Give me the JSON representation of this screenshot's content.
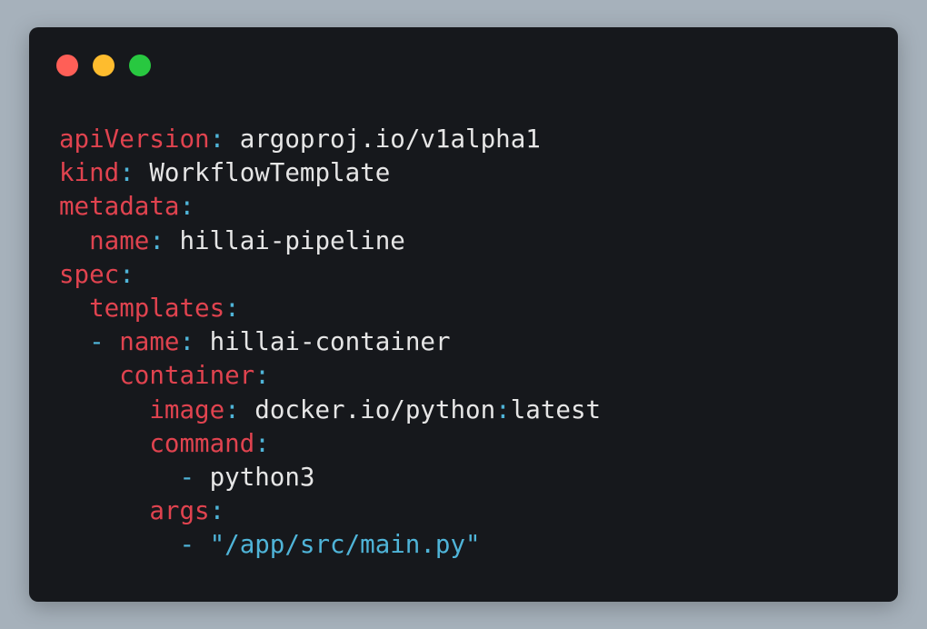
{
  "colors": {
    "page_background": "#a6b1bb",
    "window_background": "#16181c",
    "close": "#ff5f57",
    "minimize": "#febc2e",
    "maximize": "#28c840",
    "key": "#e0434f",
    "punctuation": "#4fb4d8",
    "value": "#e6e6e6",
    "string": "#4fb4d8"
  },
  "window_controls": [
    "close-button",
    "minimize-button",
    "maximize-button"
  ],
  "code": {
    "language": "yaml",
    "lines": [
      {
        "indent": "",
        "dash": "",
        "key": "apiVersion",
        "colon": ":",
        "value": " argoproj.io/v1alpha1",
        "value_type": "plain"
      },
      {
        "indent": "",
        "dash": "",
        "key": "kind",
        "colon": ":",
        "value": " WorkflowTemplate",
        "value_type": "plain"
      },
      {
        "indent": "",
        "dash": "",
        "key": "metadata",
        "colon": ":",
        "value": "",
        "value_type": "plain"
      },
      {
        "indent": "  ",
        "dash": "",
        "key": "name",
        "colon": ":",
        "value": " hillai-pipeline",
        "value_type": "plain"
      },
      {
        "indent": "",
        "dash": "",
        "key": "spec",
        "colon": ":",
        "value": "",
        "value_type": "plain"
      },
      {
        "indent": "  ",
        "dash": "",
        "key": "templates",
        "colon": ":",
        "value": "",
        "value_type": "plain"
      },
      {
        "indent": "  ",
        "dash": "- ",
        "key": "name",
        "colon": ":",
        "value": " hillai-container",
        "value_type": "plain"
      },
      {
        "indent": "    ",
        "dash": "",
        "key": "container",
        "colon": ":",
        "value": "",
        "value_type": "plain"
      },
      {
        "indent": "      ",
        "dash": "",
        "key": "image",
        "colon": ":",
        "value": " docker.io/python:latest",
        "value_type": "image"
      },
      {
        "indent": "      ",
        "dash": "",
        "key": "command",
        "colon": ":",
        "value": "",
        "value_type": "plain"
      },
      {
        "indent": "        ",
        "dash": "- ",
        "key": "",
        "colon": "",
        "value": "python3",
        "value_type": "plain"
      },
      {
        "indent": "      ",
        "dash": "",
        "key": "args",
        "colon": ":",
        "value": "",
        "value_type": "plain"
      },
      {
        "indent": "        ",
        "dash": "- ",
        "key": "",
        "colon": "",
        "value": "\"/app/src/main.py\"",
        "value_type": "string"
      }
    ]
  }
}
